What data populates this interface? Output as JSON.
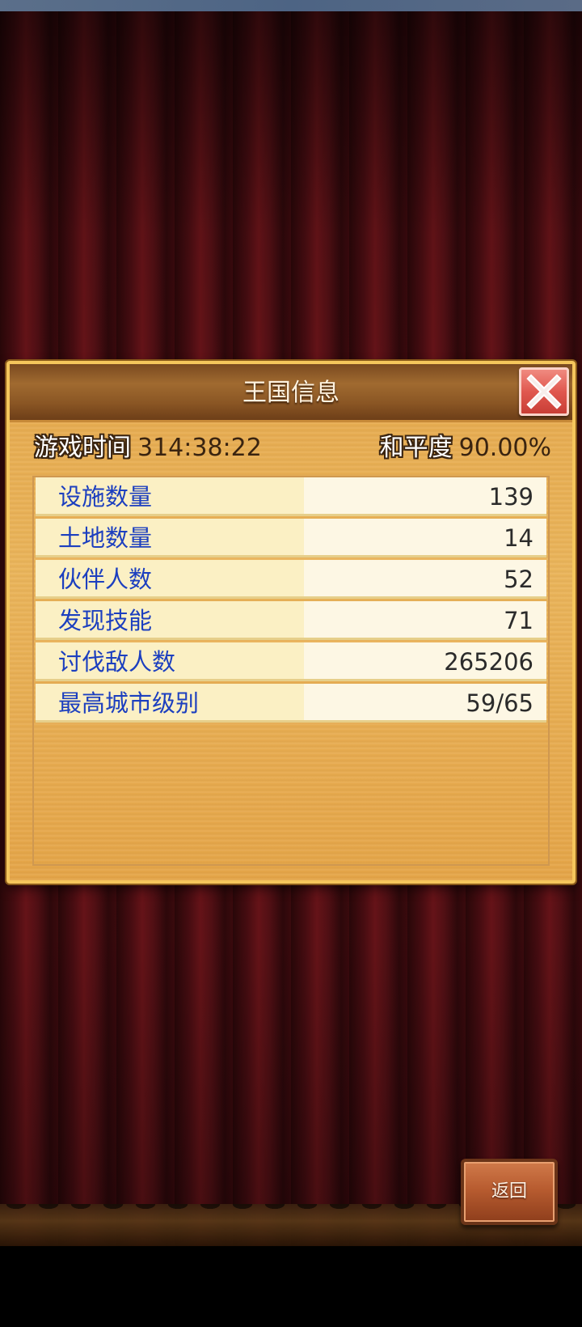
{
  "panel": {
    "title": "王国信息",
    "close_icon": "close-x-icon"
  },
  "summary": {
    "play_time_label": "游戏时间",
    "play_time_value": "314:38:22",
    "peace_label": "和平度",
    "peace_value": "90.00%"
  },
  "stats": [
    {
      "label": "设施数量",
      "value": "139"
    },
    {
      "label": "土地数量",
      "value": "14"
    },
    {
      "label": "伙伴人数",
      "value": "52"
    },
    {
      "label": "发现技能",
      "value": "71"
    },
    {
      "label": "讨伐敌人数",
      "value": "265206"
    },
    {
      "label": "最高城市级别",
      "value": "59/65"
    }
  ],
  "back_button": {
    "label": "返回"
  }
}
